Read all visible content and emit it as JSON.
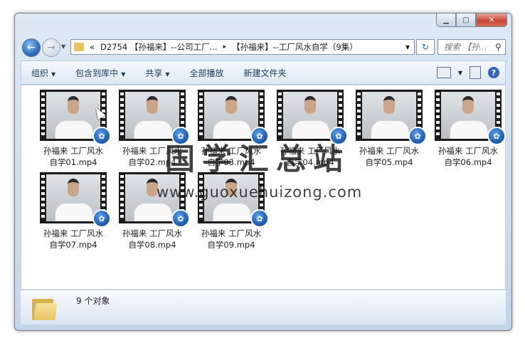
{
  "window": {
    "caption_buttons": {
      "minimize": "▁",
      "maximize": "▢",
      "close": "✕"
    }
  },
  "address": {
    "chevron": "«",
    "segments": [
      "D2754 【孙福来】--公司工厂...",
      "【孙福来】--工厂风水自学（9集）"
    ],
    "separator": "▸"
  },
  "search": {
    "placeholder": "搜索 【孙..."
  },
  "toolbar": {
    "organize": "组织",
    "include_library": "包含到库中",
    "share": "共享",
    "play_all": "全部播放",
    "new_folder": "新建文件夹"
  },
  "files": [
    {
      "line1": "孙福来 工厂风水",
      "line2": "自学01.mp4"
    },
    {
      "line1": "孙福来 工厂风水",
      "line2": "自学02.mp4"
    },
    {
      "line1": "孙福来 工厂风水",
      "line2": "自学03.mp4"
    },
    {
      "line1": "孙福来 工厂风水",
      "line2": "自学04.mp4"
    },
    {
      "line1": "孙福来 工厂风水",
      "line2": "自学05.mp4"
    },
    {
      "line1": "孙福来 工厂风水",
      "line2": "自学06.mp4"
    },
    {
      "line1": "孙福来 工厂风水",
      "line2": "自学07.mp4"
    },
    {
      "line1": "孙福来 工厂风水",
      "line2": "自学08.mp4"
    },
    {
      "line1": "孙福来 工厂风水",
      "line2": "自学09.mp4"
    }
  ],
  "watermark": {
    "text": "国学汇总站",
    "url": "www.guoxuehuizong.com"
  },
  "details": {
    "count": "9 个对象"
  },
  "icons": {
    "back": "back-arrow-icon",
    "forward": "forward-arrow-icon",
    "refresh": "refresh-icon",
    "search": "magnifier-icon",
    "help": "help-icon",
    "badge": "media-player-icon",
    "folder": "folder-icon"
  },
  "colors": {
    "accent": "#2e66b8",
    "toolbar_text": "#1e395b",
    "close_button": "#c8463a"
  }
}
